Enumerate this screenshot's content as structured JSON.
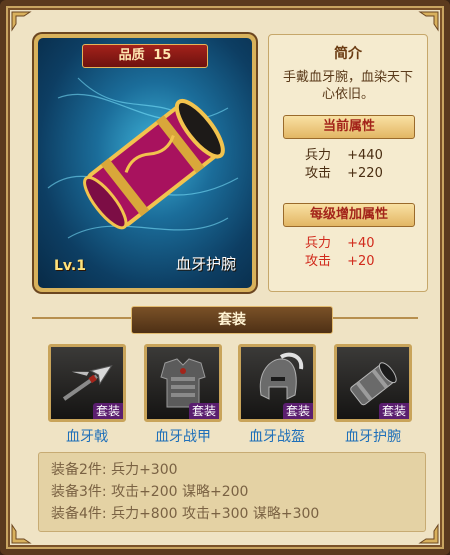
{
  "item": {
    "quality_label": "品质",
    "quality_value": "15",
    "level": "Lv.1",
    "name": "血牙护腕"
  },
  "info": {
    "title": "简介",
    "description": "手戴血牙腕，血染天下心依旧。",
    "current_header": "当前属性",
    "current_stats": [
      {
        "key": "兵力",
        "value": "+440"
      },
      {
        "key": "攻击",
        "value": "+220"
      }
    ],
    "growth_header": "每级增加属性",
    "growth_stats": [
      {
        "key": "兵力",
        "value": "+40"
      },
      {
        "key": "攻击",
        "value": "+20"
      }
    ]
  },
  "set": {
    "title": "套装",
    "tag": "套装",
    "pieces": [
      {
        "name": "血牙戟",
        "icon": "halberd-icon"
      },
      {
        "name": "血牙战甲",
        "icon": "armor-icon"
      },
      {
        "name": "血牙战盔",
        "icon": "helmet-icon"
      },
      {
        "name": "血牙护腕",
        "icon": "bracer-icon"
      }
    ],
    "bonuses": [
      "装备2件: 兵力+300",
      "装备3件: 攻击+200 谋略+200",
      "装备4件: 兵力+800 攻击+300 谋略+300"
    ]
  },
  "colors": {
    "background": "#efe3c4",
    "accent_red": "#d12a1c",
    "link_blue": "#1e6fb9",
    "tag_purple": "#5a1e6f"
  }
}
